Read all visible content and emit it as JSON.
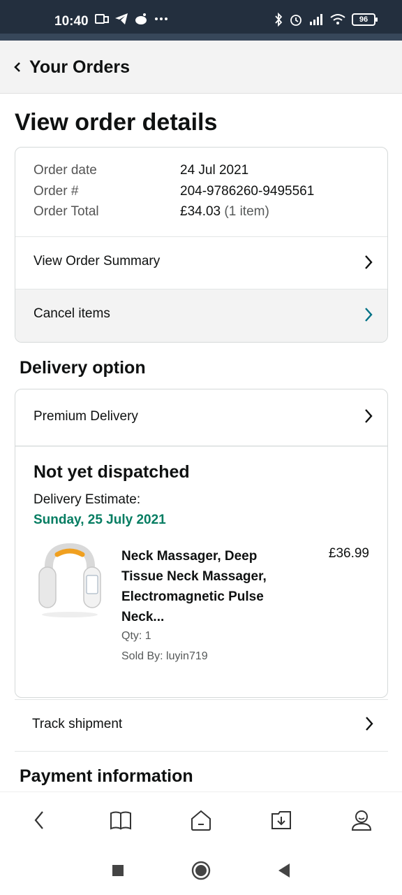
{
  "status_bar": {
    "time": "10:40",
    "battery": "96"
  },
  "header": {
    "title": "Your Orders"
  },
  "page": {
    "title": "View order details"
  },
  "order_info": {
    "date_label": "Order date",
    "date_value": "24 Jul 2021",
    "number_label": "Order #",
    "number_value": "204-9786260-9495561",
    "total_label": "Order Total",
    "total_value": "£34.03",
    "total_items": "(1 item)",
    "summary_link": "View Order Summary",
    "cancel_link": "Cancel items"
  },
  "delivery": {
    "section_title": "Delivery option",
    "option": "Premium Delivery",
    "status": "Not yet dispatched",
    "estimate_label": "Delivery Estimate:",
    "estimate_date": "Sunday, 25 July 2021",
    "product": {
      "name": "Neck Massager, Deep Tissue Neck Massager, Electromagnetic Pulse Neck...",
      "price": "£36.99",
      "qty": "Qty: 1",
      "seller": "Sold By: luyin719"
    }
  },
  "track": {
    "label": "Track shipment"
  },
  "payment": {
    "section_title": "Payment information"
  },
  "colors": {
    "status_bar": "#232f3e",
    "estimate_green": "#067d62",
    "teal_chevron": "#007185"
  },
  "icons": {
    "bottom_nav": [
      "back-icon",
      "book-icon",
      "home-icon",
      "download-icon",
      "profile-icon"
    ],
    "system_nav": [
      "recents-icon",
      "home-icon",
      "back-icon"
    ]
  }
}
